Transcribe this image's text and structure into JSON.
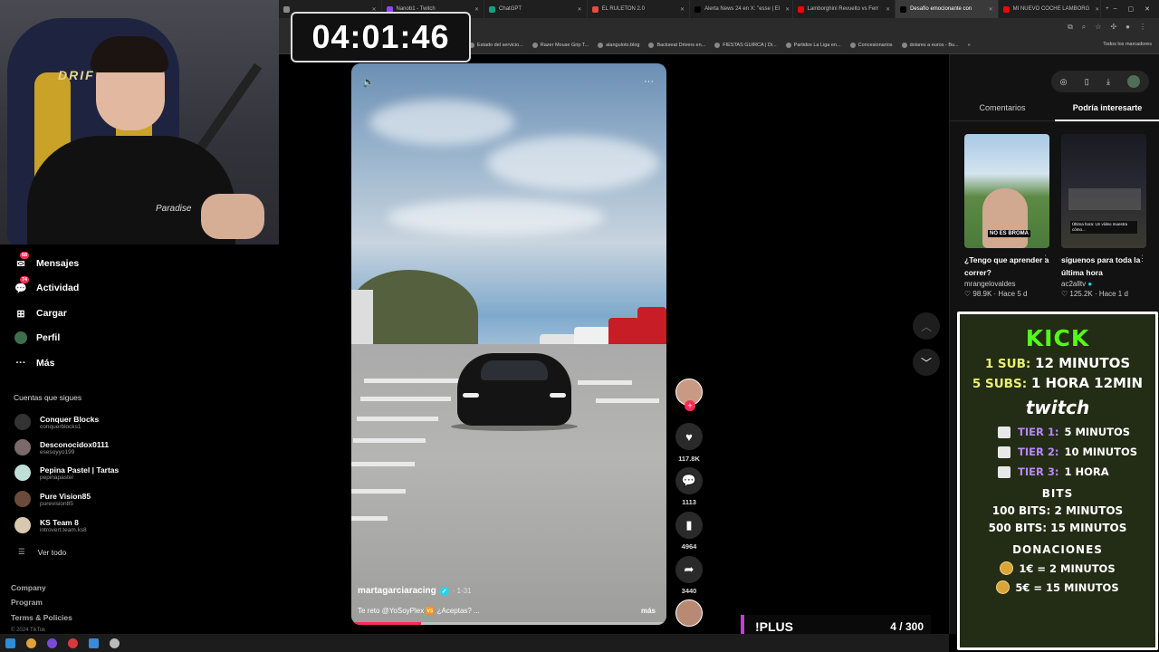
{
  "timer": "04:01:46",
  "browser": {
    "tabs": [
      {
        "label": "",
        "color": "#888"
      },
      {
        "label": "Nanob1 - Twitch",
        "color": "#9146ff"
      },
      {
        "label": "ChatGPT",
        "color": "#10a37f"
      },
      {
        "label": "EL RULETON 2.0",
        "color": "#e74c3c"
      },
      {
        "label": "Alerta News 24 en X: \"esse | El",
        "color": "#000"
      },
      {
        "label": "Lamborghini Revuelto vs Ferr",
        "color": "#ff0000"
      },
      {
        "label": "Desafío emocionante con",
        "color": "#000",
        "active": true
      },
      {
        "label": "MI NUEVO COCHE LAMBORG",
        "color": "#ff0000"
      }
    ],
    "new_tab": "+",
    "window_controls": [
      "–",
      "▢",
      "✕"
    ],
    "bookmarks": [
      {
        "label": "Estado del servicio..."
      },
      {
        "label": "Razer Mouse Grip T..."
      },
      {
        "label": "alanguloto.blog"
      },
      {
        "label": "Backseat Drivers en..."
      },
      {
        "label": "FIESTAS GUIRCA | Di..."
      },
      {
        "label": "Partidos La Liga en..."
      },
      {
        "label": "Concesionarios"
      },
      {
        "label": "dolares a euros - Bu..."
      }
    ],
    "bookmarks_more": "»",
    "bookmarks_all": "Todos los marcadores"
  },
  "sidebar": {
    "items": [
      {
        "label": "Mensajes",
        "badge": "68"
      },
      {
        "label": "Actividad",
        "badge": "74"
      },
      {
        "label": "Cargar",
        "badge": ""
      },
      {
        "label": "Perfil",
        "badge": ""
      },
      {
        "label": "Más",
        "badge": ""
      }
    ],
    "following_title": "Cuentas que sigues",
    "accounts": [
      {
        "name": "Conquer Blocks",
        "handle": "conquerblocks1"
      },
      {
        "name": "Desconocidox0111",
        "handle": "esesoyyo199"
      },
      {
        "name": "Pepina Pastel | Tartas",
        "handle": "pepinapastel"
      },
      {
        "name": "Pure Vision85",
        "handle": "purevision85"
      },
      {
        "name": "KS Team 8",
        "handle": "introvert.team.ks8"
      }
    ],
    "see_all": "Ver todo",
    "footer": [
      "Company",
      "Program",
      "Terms & Policies"
    ],
    "copyright": "© 2024 TikTok"
  },
  "video": {
    "username": "martagarciaracing",
    "date": "· 1-31",
    "caption": "Te reto @YoSoyPlex 🆚 ¿Aceptas? ...",
    "more": "más",
    "progress": 0.22
  },
  "actions": {
    "likes": "117.8K",
    "comments": "1113",
    "saves": "4964",
    "shares": "3440"
  },
  "right_panel": {
    "tabs": [
      "Comentarios",
      "Podría interesarte"
    ],
    "active_tab": 1,
    "recommendations": [
      {
        "title": "¿Tengo que aprender a correr?",
        "user": "mrangelovaldes",
        "views": "98.9K",
        "time": "Hace 5 d",
        "thumb_text": "NO ES BROMA"
      },
      {
        "title": "síguenos para toda la última hora",
        "user": "ac2alltv",
        "views": "125.2K",
        "time": "Hace 1 d",
        "thumb_text": "Última hora: Un vídeo muestra cómo..."
      }
    ]
  },
  "overlay": {
    "kick_title": "KICK",
    "kick_lines": [
      {
        "qty": "1 SUB:",
        "val": "12 MINUTOS"
      },
      {
        "qty": "5 SUBS:",
        "val": "1 HORA 12MIN"
      }
    ],
    "twitch_title": "twitch",
    "tiers": [
      {
        "name": "TIER 1:",
        "val": "5 MINUTOS"
      },
      {
        "name": "TIER 2:",
        "val": "10 MINUTOS"
      },
      {
        "name": "TIER 3:",
        "val": "1 HORA"
      }
    ],
    "bits_title": "BITS",
    "bits": [
      "100 BITS: 2 MINUTOS",
      "500 BITS: 15 MINUTOS"
    ],
    "donations_title": "DONACIONES",
    "donations": [
      "1€ = 2 MINUTOS",
      "5€ = 15 MINUTOS"
    ]
  },
  "plus": {
    "label": "!PLUS",
    "count": "4 / 300"
  }
}
